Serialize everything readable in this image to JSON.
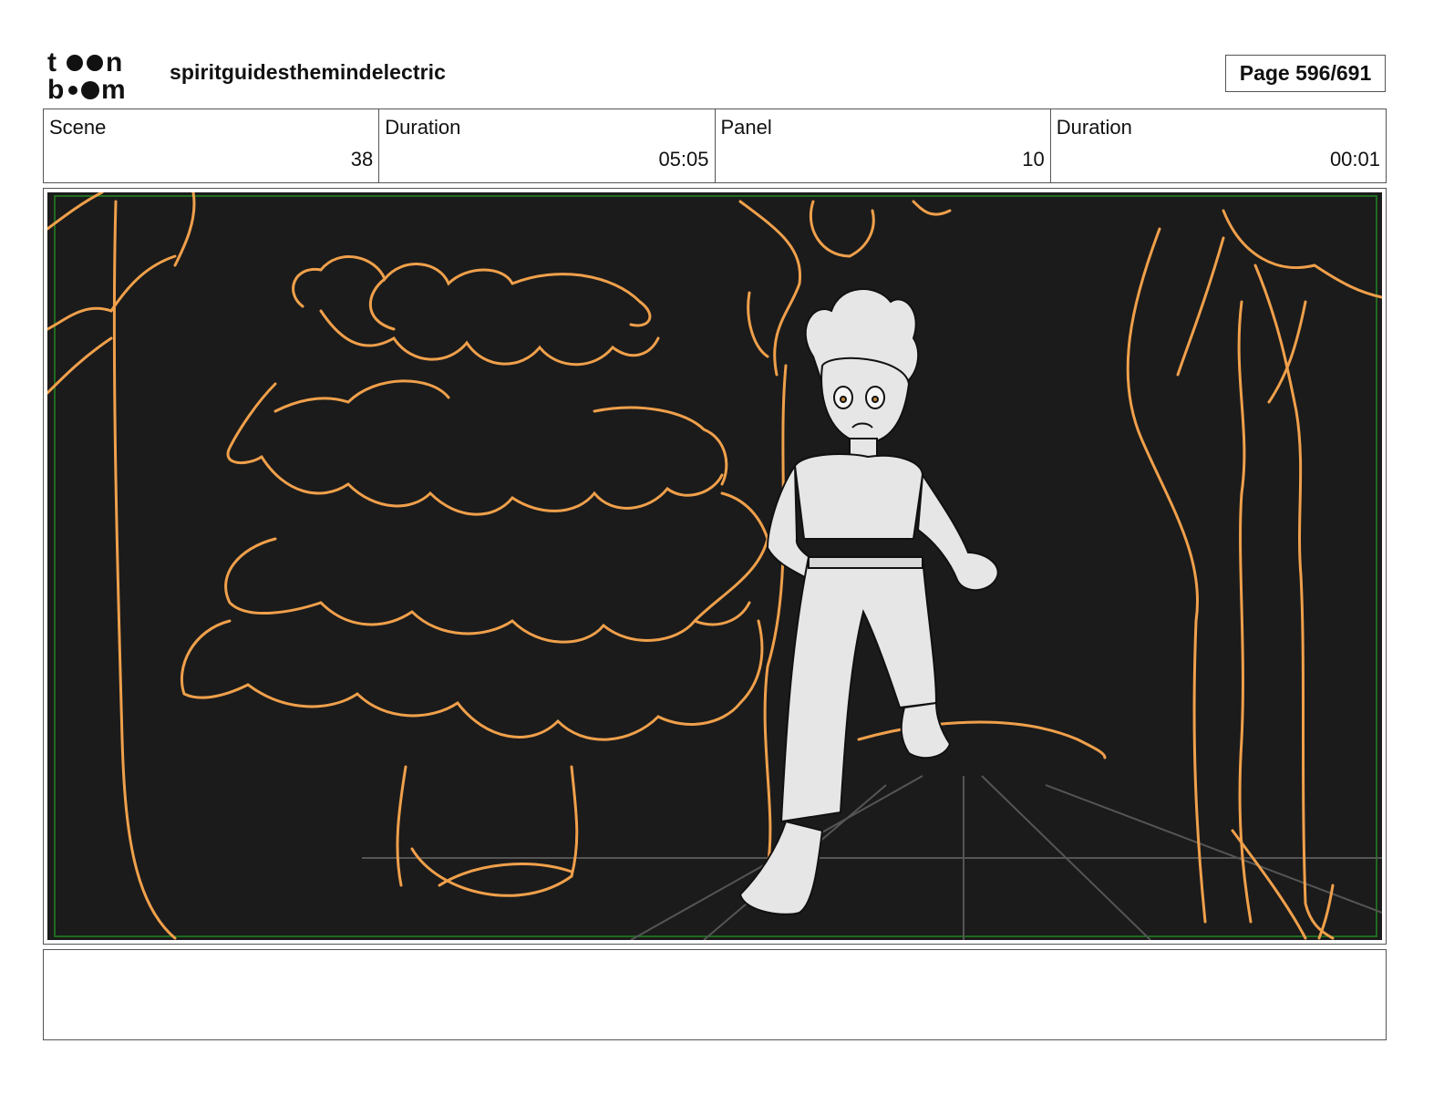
{
  "header": {
    "logo_line1": "toon",
    "logo_line2": "boom",
    "project_title": "spiritguidesthemindelectric",
    "page_label": "Page 596/691"
  },
  "info": {
    "scene_label": "Scene",
    "scene_value": "38",
    "scene_duration_label": "Duration",
    "scene_duration_value": "05:05",
    "panel_label": "Panel",
    "panel_value": "10",
    "panel_duration_label": "Duration",
    "panel_duration_value": "00:01"
  },
  "panel": {
    "background_color": "#1b1b1b",
    "line_color": "#f0a04b",
    "safe_frame_color": "#1f6b1f",
    "figure_color": "#e6e6e6"
  },
  "caption": {
    "text": ""
  }
}
